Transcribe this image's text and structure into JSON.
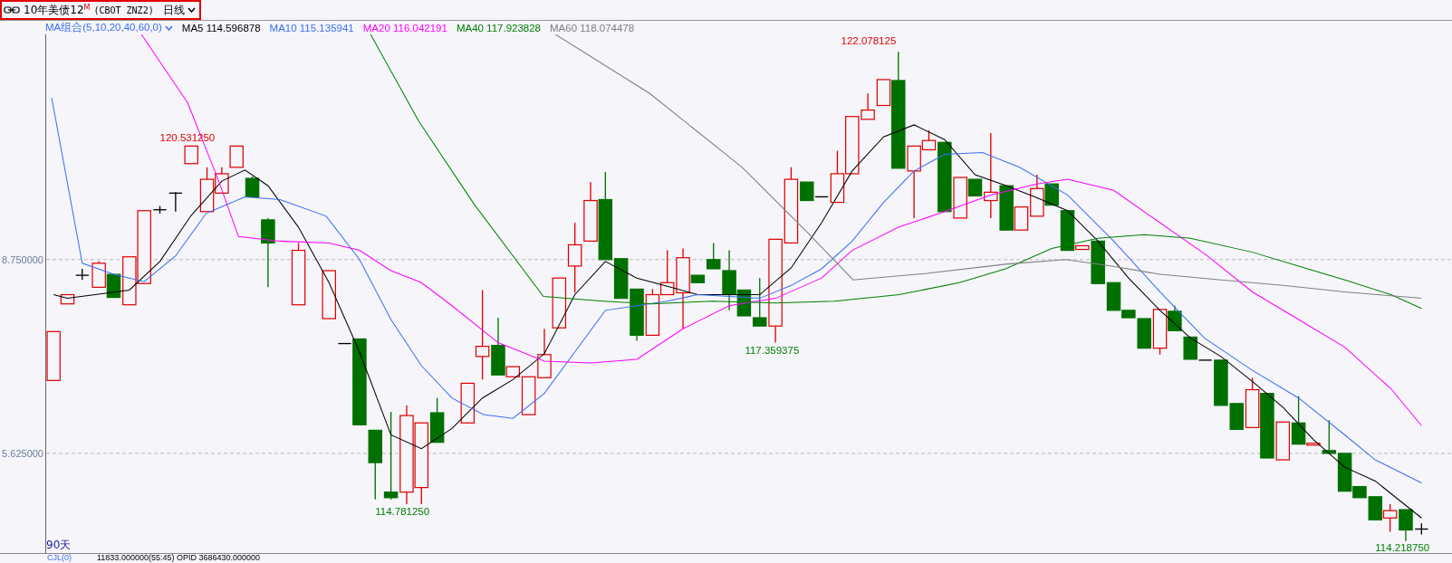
{
  "header": {
    "title": "10年美债12",
    "badge": "M",
    "symbol": "(CBOT ZNZ2)",
    "period": "日线"
  },
  "legend": {
    "group": "MA组合(5,10,20,40,60,0)",
    "items": [
      {
        "label": "MA5 114.596878",
        "color": "#000000"
      },
      {
        "label": "MA10 115.135941",
        "color": "#3d6ff2"
      },
      {
        "label": "MA20 116.042191",
        "color": "#ff00ff"
      },
      {
        "label": "MA40 117.923828",
        "color": "#008000"
      },
      {
        "label": "MA60 118.074478",
        "color": "#808080"
      }
    ]
  },
  "y_axis": {
    "labels": [
      "8.750000",
      "5.625000"
    ]
  },
  "price_labels": [
    {
      "text": "120.531250",
      "kind": "high"
    },
    {
      "text": "122.078125",
      "kind": "high"
    },
    {
      "text": "117.359375",
      "kind": "low"
    },
    {
      "text": "114.781250",
      "kind": "low"
    },
    {
      "text": "114.218750",
      "kind": "low"
    }
  ],
  "range_label": "90天",
  "indicator": {
    "name": "CJL(0)",
    "reading": "11833.000000(55:45)  OPID 3686430.000000"
  }
}
